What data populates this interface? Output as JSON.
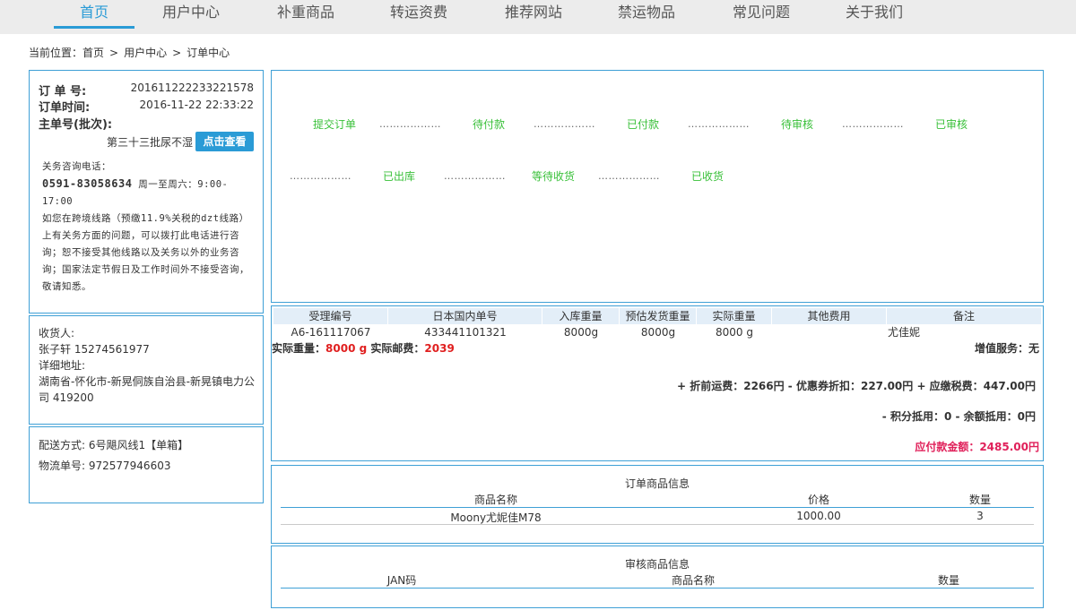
{
  "nav": {
    "items": [
      "首页",
      "用户中心",
      "补重商品",
      "转运资费",
      "推荐网站",
      "禁运物品",
      "常见问题",
      "关于我们"
    ],
    "active_index": 0
  },
  "breadcrumb": {
    "prefix": "当前位置：",
    "items": [
      "首页",
      "用户中心",
      "订单中心"
    ],
    "separator": ">"
  },
  "order": {
    "no_label": "订 单 号:",
    "no_value": "201611222233221578",
    "time_label": "订单时间:",
    "time_value": "2016-11-22 22:33:22",
    "batch_label": "主单号(批次):",
    "batch_value": "第三十三批尿不湿",
    "check_button": "点击查看"
  },
  "notice": {
    "heading": "关务咨询电话：",
    "phone": "0591-83058634",
    "hours": "周一至周六：9:00-17:00",
    "body": "如您在跨境线路（预缴11.9%关税的dzt线路）上有关务方面的问题，可以拨打此电话进行咨询；恕不接受其他线路以及关务以外的业务咨询；国家法定节假日及工作时间外不接受咨询，敬请知悉。"
  },
  "receiver": {
    "label": "收货人:",
    "name_phone": "张子轩 15274561977",
    "address_label": "详细地址:",
    "address": "湖南省-怀化市-新晃侗族自治县-新晃镇电力公司 419200"
  },
  "shipping": {
    "method": "配送方式: 6号飓风线1【单箱】",
    "tracking": "物流单号: 972577946603"
  },
  "progress": {
    "row1": [
      "提交订单",
      "待付款",
      "已付款",
      "待审核",
      "已审核"
    ],
    "row2": [
      "已出库",
      "等待收货",
      "已收货"
    ],
    "dots": "………………"
  },
  "shipment_table": {
    "headers": [
      "受理编号",
      "日本国内单号",
      "入库重量",
      "预估发货重量",
      "实际重量",
      "其他费用",
      "备注"
    ],
    "row": [
      "A6-161117067",
      "433441101321",
      "8000g",
      "8000g",
      "8000 g",
      "",
      "尤佳妮"
    ],
    "actual_weight_label": "实际重量：",
    "actual_weight_value": "8000 g",
    "actual_postage_label": "实际邮费：",
    "actual_postage_value": "2039",
    "value_added_label": "增值服务：",
    "value_added_value": "无",
    "fee_line1": "+ 折前运费：2266円 - 优惠券折扣：227.00円 + 应缴税费：447.00円",
    "fee_line2": "- 积分抵用：0 - 余额抵用：0円",
    "payable": "应付款金额：2485.00円"
  },
  "goods": {
    "title": "订单商品信息",
    "headers": [
      "商品名称",
      "价格",
      "数量"
    ],
    "rows": [
      [
        "Moony尤妮佳M78",
        "1000.00",
        "3"
      ]
    ]
  },
  "audit": {
    "title": "审核商品信息",
    "headers": [
      "JAN码",
      "商品名称",
      "数量"
    ]
  },
  "colors": {
    "accent": "#2a9bd6",
    "step_green": "#39c039",
    "red": "#e02020",
    "pay": "#e0205a"
  }
}
